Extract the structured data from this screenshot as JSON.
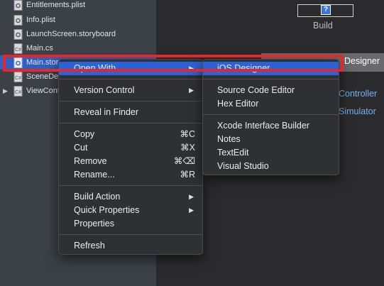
{
  "colors": {
    "sidebar_bg": "#3c4148",
    "selection": "#2f5fc4",
    "menu_bg": "#2f3033",
    "menu_highlight": "#2a63d9",
    "callout": "#e3282a",
    "link": "#6fb4f3"
  },
  "tree": {
    "items": [
      {
        "label": "Entitlements.plist",
        "icon": "plist-file-icon"
      },
      {
        "label": "Info.plist",
        "icon": "plist-file-icon"
      },
      {
        "label": "LaunchScreen.storyboard",
        "icon": "storyboard-file-icon"
      },
      {
        "label": "Main.cs",
        "icon": "csharp-file-icon"
      },
      {
        "label": "Main.stor",
        "icon": "storyboard-file-icon",
        "selected": true
      },
      {
        "label": "SceneDe",
        "icon": "csharp-file-icon"
      },
      {
        "label": "ViewCont",
        "icon": "csharp-file-icon",
        "disclosure": "▶"
      }
    ]
  },
  "build": {
    "label": "Build",
    "icon_glyph": "?"
  },
  "designer_strip": {
    "label": "Designer"
  },
  "right_links": {
    "controller": "Controller",
    "simulator": "Simulator"
  },
  "context_menu": {
    "items": [
      {
        "label": "Open With",
        "arrow": "▶",
        "highlight": true
      },
      {
        "label": "Version Control",
        "arrow": "▶"
      },
      {
        "label": "Reveal in Finder"
      },
      {
        "label": "Copy",
        "shortcut": "⌘C"
      },
      {
        "label": "Cut",
        "shortcut": "⌘X"
      },
      {
        "label": "Remove",
        "shortcut": "⌘⌫"
      },
      {
        "label": "Rename...",
        "shortcut": "⌘R"
      },
      {
        "label": "Build Action",
        "arrow": "▶"
      },
      {
        "label": "Quick Properties",
        "arrow": "▶"
      },
      {
        "label": "Properties"
      },
      {
        "label": "Refresh"
      }
    ]
  },
  "open_with_submenu": {
    "items": [
      {
        "label": "iOS Designer",
        "highlight": true
      },
      {
        "label": "Source Code Editor"
      },
      {
        "label": "Hex Editor"
      },
      {
        "label": "Xcode Interface Builder"
      },
      {
        "label": "Notes"
      },
      {
        "label": "TextEdit"
      },
      {
        "label": "Visual Studio"
      }
    ]
  }
}
